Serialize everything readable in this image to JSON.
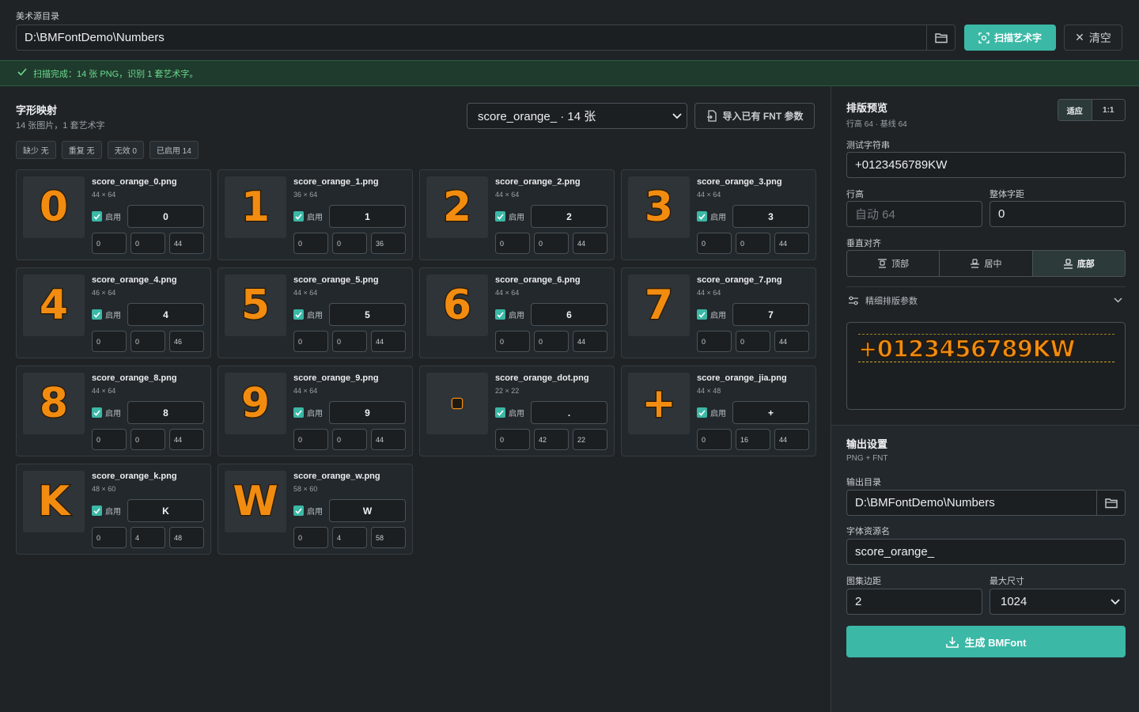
{
  "source": {
    "label": "美术源目录",
    "path": "D:\\BMFontDemo\\Numbers",
    "scan_label": "扫描艺术字",
    "clear_label": "清空"
  },
  "status": {
    "text": "扫描完成：14 张 PNG，识别 1 套艺术字。"
  },
  "mapping": {
    "title": "字形映射",
    "subtitle": "14 张图片，1 套艺术字",
    "set_selected": "score_orange_ · 14 张",
    "import_label": "导入已有 FNT 参数",
    "chips": [
      "缺少 无",
      "重复 无",
      "无效 0",
      "已启用 14"
    ],
    "enabled_label": "启用",
    "glyphs": [
      {
        "file": "score_orange_0.png",
        "dims": "44 × 64",
        "glyph": "0",
        "char": "0",
        "a": "0",
        "b": "0",
        "c": "44"
      },
      {
        "file": "score_orange_1.png",
        "dims": "36 × 64",
        "glyph": "1",
        "char": "1",
        "a": "0",
        "b": "0",
        "c": "36"
      },
      {
        "file": "score_orange_2.png",
        "dims": "44 × 64",
        "glyph": "2",
        "char": "2",
        "a": "0",
        "b": "0",
        "c": "44"
      },
      {
        "file": "score_orange_3.png",
        "dims": "44 × 64",
        "glyph": "3",
        "char": "3",
        "a": "0",
        "b": "0",
        "c": "44"
      },
      {
        "file": "score_orange_4.png",
        "dims": "46 × 64",
        "glyph": "4",
        "char": "4",
        "a": "0",
        "b": "0",
        "c": "46"
      },
      {
        "file": "score_orange_5.png",
        "dims": "44 × 64",
        "glyph": "5",
        "char": "5",
        "a": "0",
        "b": "0",
        "c": "44"
      },
      {
        "file": "score_orange_6.png",
        "dims": "44 × 64",
        "glyph": "6",
        "char": "6",
        "a": "0",
        "b": "0",
        "c": "44"
      },
      {
        "file": "score_orange_7.png",
        "dims": "44 × 64",
        "glyph": "7",
        "char": "7",
        "a": "0",
        "b": "0",
        "c": "44"
      },
      {
        "file": "score_orange_8.png",
        "dims": "44 × 64",
        "glyph": "8",
        "char": "8",
        "a": "0",
        "b": "0",
        "c": "44"
      },
      {
        "file": "score_orange_9.png",
        "dims": "44 × 64",
        "glyph": "9",
        "char": "9",
        "a": "0",
        "b": "0",
        "c": "44"
      },
      {
        "file": "score_orange_dot.png",
        "dims": "22 × 22",
        "glyph": "▫",
        "char": ".",
        "a": "0",
        "b": "42",
        "c": "22"
      },
      {
        "file": "score_orange_jia.png",
        "dims": "44 × 48",
        "glyph": "+",
        "char": "+",
        "a": "0",
        "b": "16",
        "c": "44"
      },
      {
        "file": "score_orange_k.png",
        "dims": "48 × 60",
        "glyph": "K",
        "char": "K",
        "a": "0",
        "b": "4",
        "c": "48"
      },
      {
        "file": "score_orange_w.png",
        "dims": "58 × 60",
        "glyph": "W",
        "char": "W",
        "a": "0",
        "b": "4",
        "c": "58"
      }
    ]
  },
  "preview": {
    "title": "排版预览",
    "subtitle": "行高 64 · 基线 64",
    "fit_label": "适应",
    "one_label": "1:1",
    "test_label": "测试字符串",
    "test_value": "+0123456789KW",
    "line_height_label": "行高",
    "line_height_placeholder": "自动 64",
    "spacing_label": "整体字距",
    "spacing_value": "0",
    "valign_label": "垂直对齐",
    "valign_options": [
      "顶部",
      "居中",
      "底部"
    ],
    "valign_selected": "底部",
    "fine_label": "精细排版参数",
    "rendered": "+0123456789KW"
  },
  "output": {
    "title": "输出设置",
    "subtitle": "PNG + FNT",
    "dir_label": "输出目录",
    "dir_value": "D:\\BMFontDemo\\Numbers",
    "name_label": "字体资源名",
    "name_value": "score_orange_",
    "padding_label": "图集边距",
    "padding_value": "2",
    "maxsize_label": "最大尺寸",
    "maxsize_value": "1024",
    "generate_label": "生成 BMFont"
  },
  "colors": {
    "accent": "#3bb8a6",
    "glyph_orange": "#f28c10",
    "success_bg": "#1f3b2d",
    "success_text": "#6ddc8f"
  }
}
